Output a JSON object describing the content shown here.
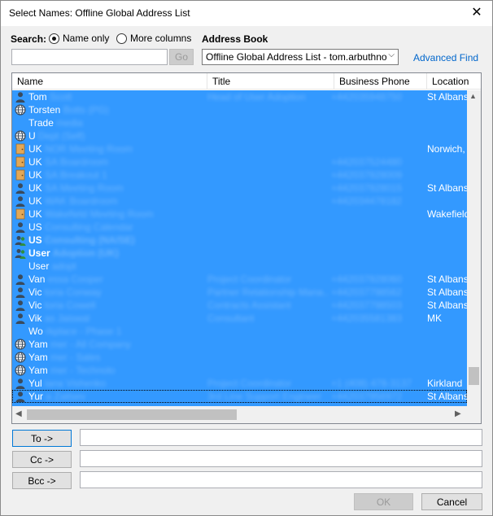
{
  "window": {
    "title": "Select Names: Offline Global Address List",
    "close_glyph": "✕"
  },
  "search": {
    "label": "Search:",
    "option_name_only": "Name only",
    "option_more_columns": "More columns",
    "selected": "name_only",
    "input_value": "",
    "go_label": "Go"
  },
  "address_book": {
    "label": "Address Book",
    "selected": "Offline Global Address List - tom.arbuthno",
    "advanced_find": "Advanced Find"
  },
  "columns": [
    "Name",
    "Title",
    "Business Phone",
    "Location"
  ],
  "rows": [
    {
      "icon": "person-icon",
      "name": "Tom",
      "name_blur": "Scott",
      "title_blur": "Head of User Adoption",
      "phone_blur": "+442035948750",
      "location": "St Albans"
    },
    {
      "icon": "globe-icon",
      "name": "Torsten",
      "name_blur": "Botts (PG)",
      "title_blur": "",
      "phone_blur": "",
      "location": ""
    },
    {
      "icon": "",
      "name": "Trade",
      "name_blur": "media",
      "title_blur": "",
      "phone_blur": "",
      "location": ""
    },
    {
      "icon": "globe-icon",
      "name": "U",
      "name_blur": "Dept (Self)",
      "title_blur": "",
      "phone_blur": "",
      "location": ""
    },
    {
      "icon": "room-icon",
      "name": "UK",
      "name_blur": "NOR Meeting Room",
      "title_blur": "",
      "phone_blur": "",
      "location": "Norwich,"
    },
    {
      "icon": "room-icon",
      "name": "UK",
      "name_blur": "SA Boardroom",
      "title_blur": "",
      "phone_blur": "+442037524480",
      "location": ""
    },
    {
      "icon": "room-icon",
      "name": "UK",
      "name_blur": "SA Breakout 1",
      "title_blur": "",
      "phone_blur": "+442037928009",
      "location": ""
    },
    {
      "icon": "person-icon",
      "name": "UK",
      "name_blur": "SA Meeting Room",
      "title_blur": "",
      "phone_blur": "+442037928015",
      "location": "St Albans"
    },
    {
      "icon": "person-icon",
      "name": "UK",
      "name_blur": "WAK Boardroom",
      "title_blur": "",
      "phone_blur": "+442034478182",
      "location": ""
    },
    {
      "icon": "room-icon",
      "name": "UK",
      "name_blur": "Wakefield Meeting Room",
      "title_blur": "",
      "phone_blur": "",
      "location": "Wakefield"
    },
    {
      "icon": "person-icon",
      "name": "US",
      "name_blur": "Consulting Calendar",
      "title_blur": "",
      "phone_blur": "",
      "location": ""
    },
    {
      "icon": "group-icon",
      "name": "US",
      "name_blur": "Consulting (NA/SE)",
      "title_blur": "",
      "phone_blur": "",
      "location": "",
      "bold": true
    },
    {
      "icon": "group-icon",
      "name": "User",
      "name_blur": "Adoption (UK)",
      "title_blur": "",
      "phone_blur": "",
      "location": "",
      "bold": true
    },
    {
      "icon": "",
      "name": "User",
      "name_blur": "adopt",
      "title_blur": "",
      "phone_blur": "",
      "location": ""
    },
    {
      "icon": "person-icon",
      "name": "Van",
      "name_blur": "essa Cooper",
      "title_blur": "Project Coordinator",
      "phone_blur": "+442037928060",
      "location": "St Albans"
    },
    {
      "icon": "person-icon",
      "name": "Vic",
      "name_blur": "toria Conway",
      "title_blur": "Partner Relationship Mana...",
      "phone_blur": "+442037798562",
      "location": "St Albans"
    },
    {
      "icon": "person-icon",
      "name": "Vic",
      "name_blur": "toria Cowell",
      "title_blur": "Contracts Assistant",
      "phone_blur": "+442037798503",
      "location": "St Albans"
    },
    {
      "icon": "person-icon",
      "name": "Vik",
      "name_blur": "as Jaiswal",
      "title_blur": "Consultant",
      "phone_blur": "+442035581383",
      "location": "MK"
    },
    {
      "icon": "",
      "name": "Wo",
      "name_blur": "rkplace - Phase 1",
      "title_blur": "",
      "phone_blur": "",
      "location": ""
    },
    {
      "icon": "globe-icon",
      "name": "Yam",
      "name_blur": "mer - All Company",
      "title_blur": "",
      "phone_blur": "",
      "location": ""
    },
    {
      "icon": "globe-icon",
      "name": "Yam",
      "name_blur": "mer - Sales",
      "title_blur": "",
      "phone_blur": "",
      "location": ""
    },
    {
      "icon": "globe-icon",
      "name": "Yam",
      "name_blur": "mer - Technolo",
      "title_blur": "",
      "phone_blur": "",
      "location": ""
    },
    {
      "icon": "person-icon",
      "name": "Yul",
      "name_blur": "iana Vishenko",
      "title_blur": "Project Coordinator",
      "phone_blur": "+1 (408) 478-3137",
      "location": "Kirkland"
    },
    {
      "icon": "person-icon",
      "name": "Yur",
      "name_blur": "a Zaitsev",
      "title_blur": "3rd Line Support Engineer",
      "phone_blur": "+442037956972",
      "location": "St Albans",
      "focus": true
    }
  ],
  "recipients": {
    "to_label": "To ->",
    "cc_label": "Cc ->",
    "bcc_label": "Bcc ->",
    "to_value": "",
    "cc_value": "",
    "bcc_value": ""
  },
  "footer": {
    "ok_label": "OK",
    "cancel_label": "Cancel"
  },
  "colors": {
    "selection": "#3399ff",
    "link": "#0066cc"
  },
  "scroll": {
    "vertical_fraction": 0.88,
    "horizontal_fraction": 0.0
  }
}
